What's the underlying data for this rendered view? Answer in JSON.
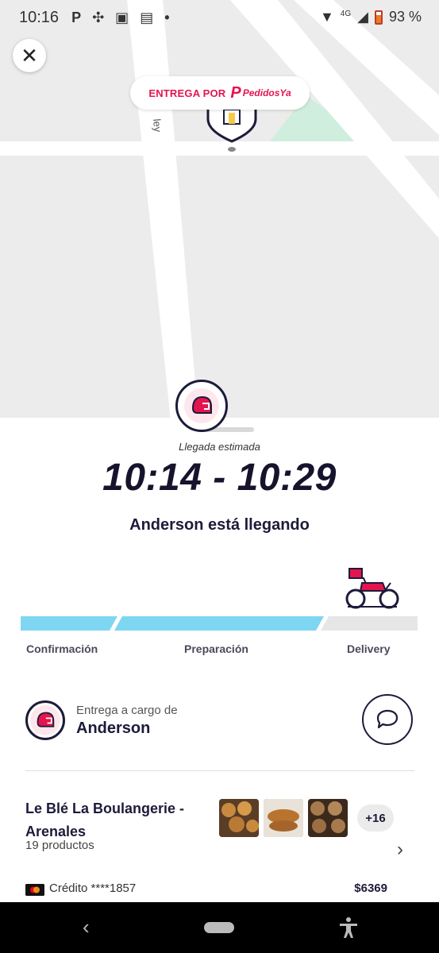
{
  "status_bar": {
    "time": "10:16",
    "network": "4G",
    "battery": "93 %"
  },
  "map": {
    "street_label": "ley",
    "close_icon": "close-icon",
    "pill": {
      "prefix": "ENTREGA POR",
      "brand": "PedidosYa",
      "brand_color": "#e4144f"
    }
  },
  "tracking": {
    "eta_label": "Llegada estimada",
    "eta_range": "10:14 - 10:29",
    "status_message": "Anderson está llegando",
    "steps": [
      "Confirmación",
      "Preparación",
      "Delivery"
    ],
    "progress_color": "#7fd6f2"
  },
  "courier": {
    "label": "Entrega a cargo de",
    "name": "Anderson"
  },
  "order": {
    "store": "Le Blé La Boulangerie - Arenales",
    "product_count": "19 productos",
    "more_items": "+16",
    "payment_method": "Crédito ****1857",
    "total": "$6369"
  }
}
